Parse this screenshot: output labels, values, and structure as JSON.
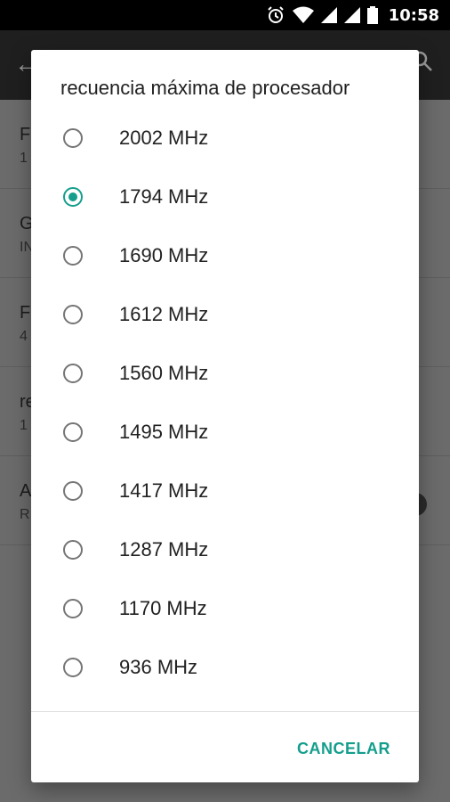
{
  "status_bar": {
    "time": "10:58",
    "icons": [
      "alarm-icon",
      "wifi-icon",
      "signal-icon",
      "signal-icon",
      "battery-icon"
    ]
  },
  "background_screen": {
    "items": [
      {
        "title": "F",
        "subtitle": "1"
      },
      {
        "title": "G",
        "subtitle": "IN"
      },
      {
        "title": "F",
        "subtitle": "4"
      },
      {
        "title": "re",
        "subtitle": "1"
      },
      {
        "title": "A",
        "subtitle": "R"
      }
    ]
  },
  "dialog": {
    "title": "recuencia máxima de procesador",
    "options": [
      {
        "label": "2002 MHz",
        "checked": false
      },
      {
        "label": "1794 MHz",
        "checked": true
      },
      {
        "label": "1690 MHz",
        "checked": false
      },
      {
        "label": "1612 MHz",
        "checked": false
      },
      {
        "label": "1560 MHz",
        "checked": false
      },
      {
        "label": "1495 MHz",
        "checked": false
      },
      {
        "label": "1417 MHz",
        "checked": false
      },
      {
        "label": "1287 MHz",
        "checked": false
      },
      {
        "label": "1170 MHz",
        "checked": false
      },
      {
        "label": "936 MHz",
        "checked": false
      }
    ],
    "cancel_label": "CANCELAR",
    "accent_color": "#159e8c"
  }
}
